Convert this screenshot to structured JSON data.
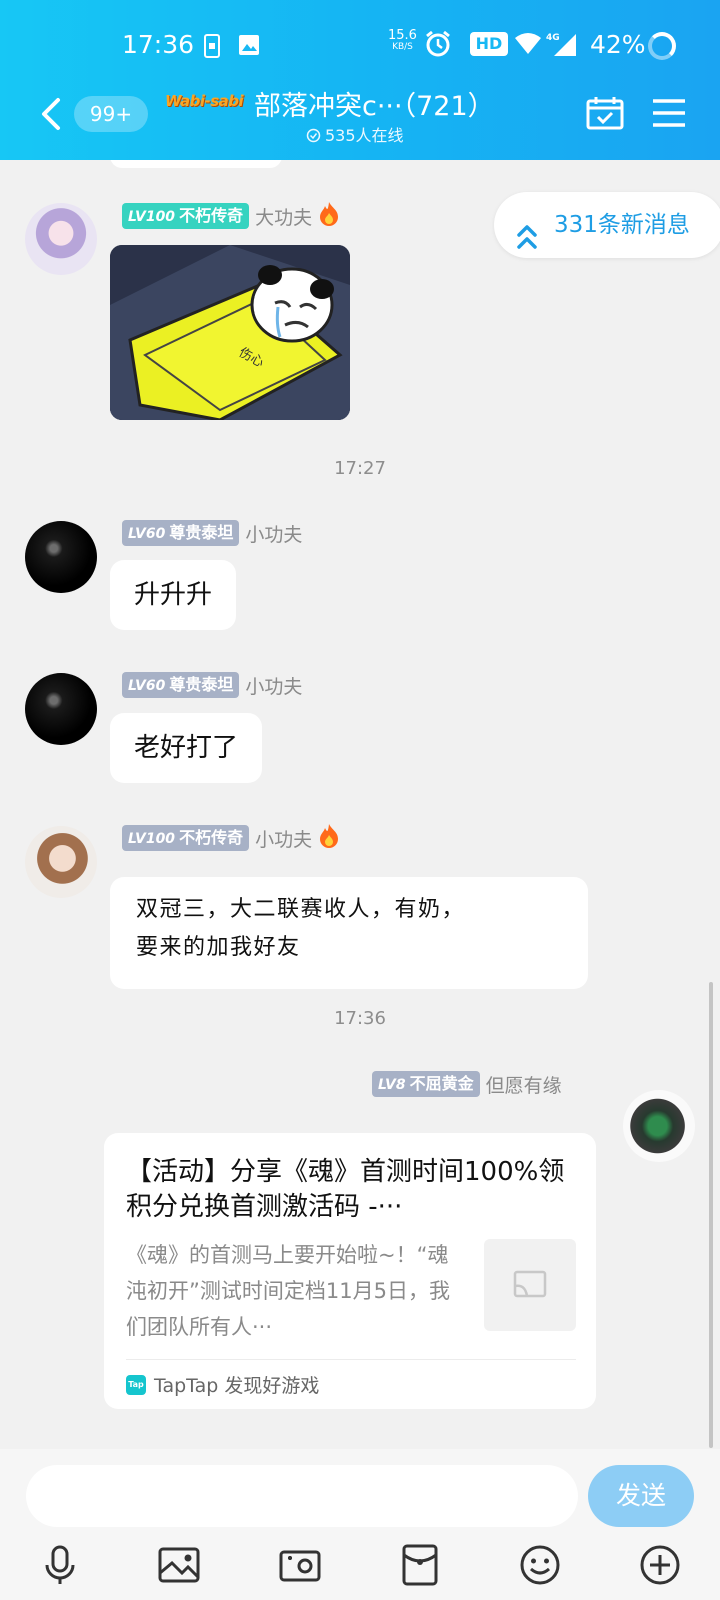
{
  "status_bar": {
    "time": "17:36",
    "net_speed_value": "15.6",
    "net_speed_unit": "KB/S",
    "hd": "HD",
    "network": "4G",
    "battery": "42%"
  },
  "header": {
    "unread_count": "99+",
    "group_logo": "Wabi-sabi",
    "group_title": "部落冲突c···（721）",
    "online": "535人在线"
  },
  "new_messages": "331条新消息",
  "messages": [
    {
      "level": "LV100",
      "rank": "不朽传奇",
      "nickname": "大功夫",
      "flame": true,
      "type": "sticker",
      "sticker_caption": "伤心"
    },
    {
      "timestamp": "17:27"
    },
    {
      "level": "LV60",
      "rank": "尊贵泰坦",
      "nickname": "小功夫",
      "type": "text",
      "text": "升升升"
    },
    {
      "level": "LV60",
      "rank": "尊贵泰坦",
      "nickname": "小功夫",
      "type": "text",
      "text": "老好打了"
    },
    {
      "level": "LV100",
      "rank": "不朽传奇",
      "nickname": "小功夫",
      "flame": true,
      "type": "text",
      "text_line1": "双冠三，大二联赛收人，有奶，",
      "text_line2": "要来的加我好友"
    },
    {
      "timestamp": "17:36"
    },
    {
      "level": "LV8",
      "rank": "不屈黄金",
      "nickname": "但愿有缘",
      "type": "card",
      "card": {
        "title": "【活动】分享《魂》首测时间100%领积分兑换首测激活码 -···",
        "description": "《魂》的首测马上要开始啦~！“魂沌初开”测试时间定档11月5日，我们团队所有人···",
        "source_logo": "Tap",
        "source": "TapTap 发现好游戏"
      }
    }
  ],
  "input": {
    "placeholder": "",
    "send_label": "发送"
  },
  "toolbar": [
    "mic-icon",
    "image-icon",
    "camera-icon",
    "red-packet-icon",
    "emoji-icon",
    "plus-icon"
  ],
  "colors": {
    "header": "#17c7f5",
    "accent": "#1e9de4",
    "send": "#8dcdf5",
    "badge_teal": "#36d3c0",
    "badge_gray": "#a7b1c6"
  }
}
